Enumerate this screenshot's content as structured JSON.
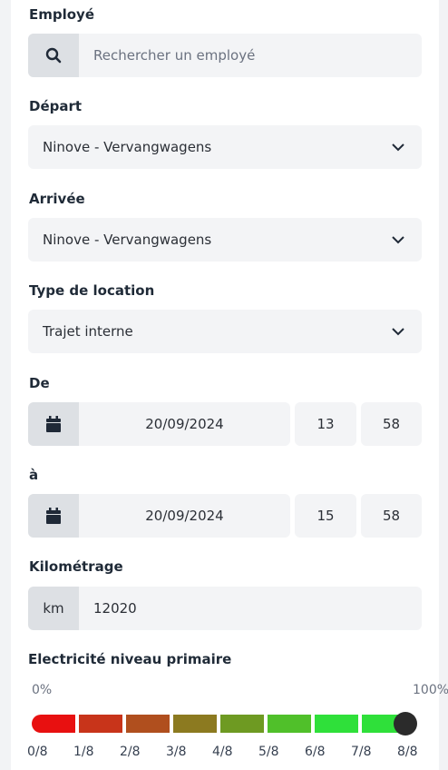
{
  "employee": {
    "label": "Employé",
    "search_placeholder": "Rechercher un employé",
    "icon": "search-icon"
  },
  "departure": {
    "label": "Départ",
    "value": "Ninove - Vervangwagens"
  },
  "arrival": {
    "label": "Arrivée",
    "value": "Ninove - Vervangwagens"
  },
  "rental_type": {
    "label": "Type de location",
    "value": "Trajet interne"
  },
  "from": {
    "label": "De",
    "date": "20/09/2024",
    "hour": "13",
    "minute": "58"
  },
  "to": {
    "label": "à",
    "date": "20/09/2024",
    "hour": "15",
    "minute": "58"
  },
  "mileage": {
    "label": "Kilométrage",
    "unit": "km",
    "value": "12020"
  },
  "electricity": {
    "label": "Electricité niveau primaire",
    "min_label": "0%",
    "max_label": "100%",
    "level_fraction": 1.0,
    "ticks": [
      "0/8",
      "1/8",
      "2/8",
      "3/8",
      "4/8",
      "5/8",
      "6/8",
      "7/8",
      "8/8"
    ],
    "segment_colors": [
      "#e81010",
      "#c8341a",
      "#b04f1e",
      "#8c7a20",
      "#6e9a22",
      "#50c02a",
      "#2fe03a",
      "#2fe03a"
    ]
  },
  "colors": {
    "field_bg": "#f3f4f6",
    "addon_bg": "#dde0e4",
    "thumb": "#2b2b2b"
  }
}
